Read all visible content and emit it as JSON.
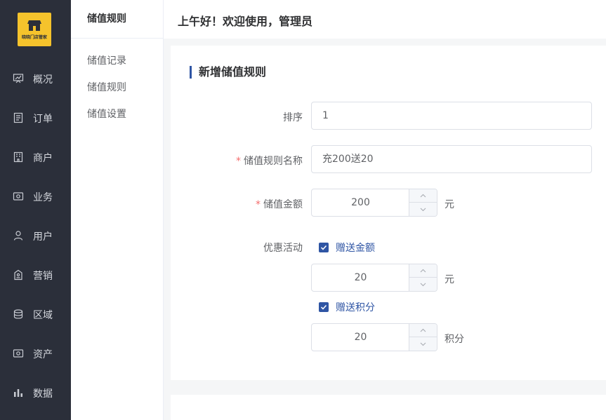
{
  "logo": {
    "text": "晓晓门店管家"
  },
  "nav": [
    {
      "label": "概况",
      "icon": "dashboard-icon"
    },
    {
      "label": "订单",
      "icon": "order-icon"
    },
    {
      "label": "商户",
      "icon": "merchant-icon"
    },
    {
      "label": "业务",
      "icon": "business-icon"
    },
    {
      "label": "用户",
      "icon": "user-icon"
    },
    {
      "label": "营销",
      "icon": "marketing-icon"
    },
    {
      "label": "区域",
      "icon": "region-icon"
    },
    {
      "label": "资产",
      "icon": "asset-icon"
    },
    {
      "label": "数据",
      "icon": "data-icon"
    }
  ],
  "submenu": {
    "title": "储值规则",
    "items": [
      "储值记录",
      "储值规则",
      "储值设置"
    ]
  },
  "header": {
    "greeting": "上午好！欢迎使用，管理员"
  },
  "form": {
    "title": "新增储值规则",
    "sort": {
      "label": "排序",
      "value": "1"
    },
    "name": {
      "label": "储值规则名称",
      "value": "充200送20"
    },
    "amount": {
      "label": "储值金额",
      "value": "200",
      "unit": "元"
    },
    "promo": {
      "label": "优惠活动",
      "gift_amount": {
        "label": "赠送金额",
        "checked": true,
        "value": "20",
        "unit": "元"
      },
      "gift_points": {
        "label": "赠送积分",
        "checked": true,
        "value": "20",
        "unit": "积分"
      }
    }
  },
  "colors": {
    "accent": "#2f55a4",
    "nav_bg": "#2b2f3a",
    "logo_bg": "#f5c32c",
    "required": "#f56c6c"
  }
}
